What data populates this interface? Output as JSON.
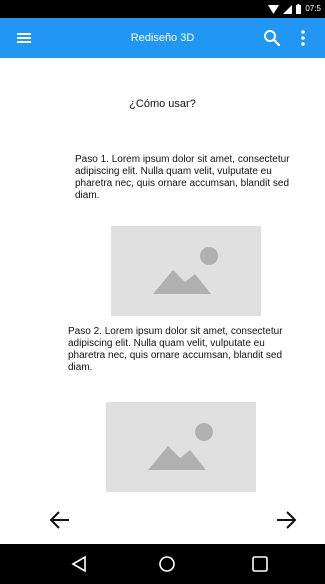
{
  "status_bar": {
    "time": "07:5"
  },
  "app_bar": {
    "title": "Rediseño 3D"
  },
  "content": {
    "heading": "¿Cómo usar?",
    "steps": [
      {
        "text": "Paso 1. Lorem ipsum dolor sit amet, consectetur adipiscing elit. Nulla quam velit, vulputate eu pharetra nec, quis ornare accumsan, blandit sed diam."
      },
      {
        "text": "Paso 2. Lorem ipsum dolor sit amet, consectetur adipiscing elit. Nulla quam velit, vulputate eu pharetra nec, quis ornare accumsan, blandit sed diam."
      }
    ]
  },
  "icons": {
    "menu": "menu-icon",
    "search": "search-icon",
    "more": "more-vertical-icon",
    "image_placeholder": "image-placeholder-icon",
    "prev": "arrow-left-icon",
    "next": "arrow-right-icon",
    "back": "back-triangle-icon",
    "home": "home-circle-icon",
    "recents": "recents-square-icon"
  },
  "colors": {
    "app_bar": "#2196f3",
    "placeholder": "#e0e0e0",
    "placeholder_glyph": "#b0b0b0",
    "system_bars": "#000000"
  }
}
